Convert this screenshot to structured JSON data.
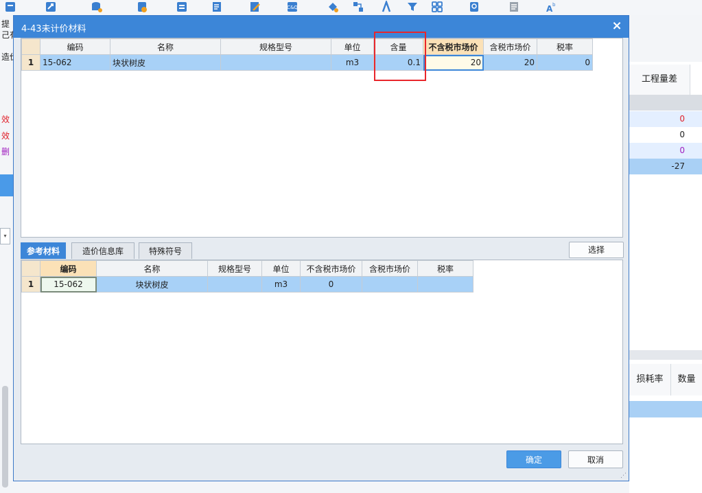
{
  "toolbar": {
    "icons": [
      "report-icon",
      "export-icon",
      "database-icon",
      "coin-icon",
      "swap-icon",
      "list-add-icon",
      "edit-icon",
      "calculator-icon",
      "paint-icon",
      "flow-icon",
      "compass-icon",
      "filter-icon",
      "grid-icon",
      "search-doc-icon",
      "document-icon",
      "text-size-icon"
    ]
  },
  "left_panel": {
    "texts": [
      "提",
      "己有",
      "造价",
      "效",
      "效",
      "删"
    ],
    "select_glyph": "▾"
  },
  "right_panel": {
    "header_engineering_diff": "工程量差",
    "rows": [
      {
        "v": "0",
        "color": "#e0202a"
      },
      {
        "v": "0",
        "color": "#222222"
      },
      {
        "v": "0",
        "color": "#a020c0"
      },
      {
        "v": "-27",
        "color": "#222222"
      }
    ],
    "header_loss_rate": "损耗率",
    "header_quantity": "数量"
  },
  "dialog": {
    "title": "4-43未计价材料",
    "close": "×",
    "upper_grid": {
      "headers": [
        "编码",
        "名称",
        "规格型号",
        "单位",
        "含量",
        "不含税市场价",
        "含税市场价",
        "税率"
      ],
      "rows": [
        {
          "num": "1",
          "code": "15-062",
          "name": "块状树皮",
          "spec": "",
          "unit": "m3",
          "content": "0.1",
          "price_ex_tax": "20",
          "price_inc_tax": "20",
          "tax_rate": "0"
        }
      ]
    },
    "tabs": [
      "参考材料",
      "造价信息库",
      "特殊符号"
    ],
    "select_button": "选择",
    "lower_grid": {
      "headers": [
        "编码",
        "名称",
        "规格型号",
        "单位",
        "不含税市场价",
        "含税市场价",
        "税率"
      ],
      "rows": [
        {
          "num": "1",
          "code": "15-062",
          "name": "块状树皮",
          "spec": "",
          "unit": "m3",
          "price_ex_tax": "0",
          "price_inc_tax": "",
          "tax_rate": ""
        }
      ]
    },
    "ok_button": "确定",
    "cancel_button": "取消"
  },
  "colors": {
    "accent": "#3c86d8",
    "selected_row": "#a8d1f7",
    "highlight_box": "#e8262b"
  }
}
